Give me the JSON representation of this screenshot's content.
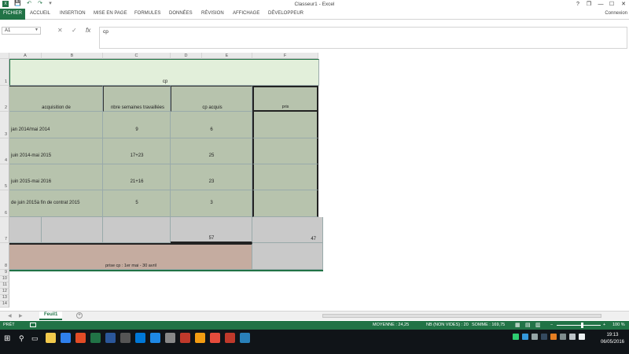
{
  "window": {
    "title": "Classeur1 - Excel",
    "help": "?",
    "restore_label": "❐",
    "minimize_label": "—",
    "maximize_label": "☐",
    "close_label": "✕",
    "signin": "Connexion"
  },
  "qat": {
    "save": "💾",
    "undo": "↶",
    "redo": "↷",
    "customize": "▾"
  },
  "ribbon": {
    "tabs": [
      "FICHIER",
      "ACCUEIL",
      "INSERTION",
      "MISE EN PAGE",
      "FORMULES",
      "DONNÉES",
      "RÉVISION",
      "AFFICHAGE",
      "DÉVELOPPEUR"
    ],
    "active": "FICHIER"
  },
  "formula_bar": {
    "name_box": "A1",
    "cancel": "✕",
    "enter": "✓",
    "fx": "fx",
    "content": "cp"
  },
  "columns": [
    "A",
    "B",
    "C",
    "D",
    "E",
    "F"
  ],
  "rows": [
    "1",
    "2",
    "3",
    "4",
    "5",
    "6",
    "7",
    "8",
    "9",
    "10",
    "11",
    "12",
    "13",
    "14"
  ],
  "cells": {
    "r1": "cp",
    "r2": {
      "a": "acquisition de",
      "c": "nbre semaines travaillées",
      "e": "cp acquis",
      "f": "pris"
    },
    "r3": {
      "a": "jan 2014/mai 2014",
      "c": "9",
      "e": "6"
    },
    "r4": {
      "a": "juin 2014-mai 2015",
      "c": "17+23",
      "e": "25"
    },
    "r5": {
      "a": "juin 2015-mai 2016",
      "c": "21+16",
      "e": "23"
    },
    "r6": {
      "a": "de juin 2015à fin de contrat 2015",
      "c": "5",
      "e": "3"
    },
    "r7": {
      "e": "57",
      "f": "47"
    },
    "r8": "prise cp : 1er mai - 30 avril"
  },
  "sheet_tabs": [
    "Feuil1"
  ],
  "sheet_add": "+",
  "status": {
    "mode": "PRÊT",
    "average": "MOYENNE : 24,25",
    "count": "NB (NON VIDES) : 20",
    "sum": "SOMME : 169,75",
    "zoom": "100 %"
  },
  "taskbar": {
    "time": "19:13",
    "date": "06/05/2016",
    "app_colors": [
      "#f2c94c",
      "#2f80ed",
      "#e34c26",
      "#217346",
      "#2b579a",
      "#555",
      "#0078d7",
      "#1e88e5",
      "#888",
      "#c0392b",
      "#f39c12",
      "#e74c3c",
      "#c0392b",
      "#2980b9"
    ]
  },
  "colors": {
    "accent": "#217346",
    "header_fill": "#e2efda",
    "body_fill": "#b7c3ad",
    "empty_fill": "#c9c9c9",
    "footer_fill": "#c5aca0"
  }
}
